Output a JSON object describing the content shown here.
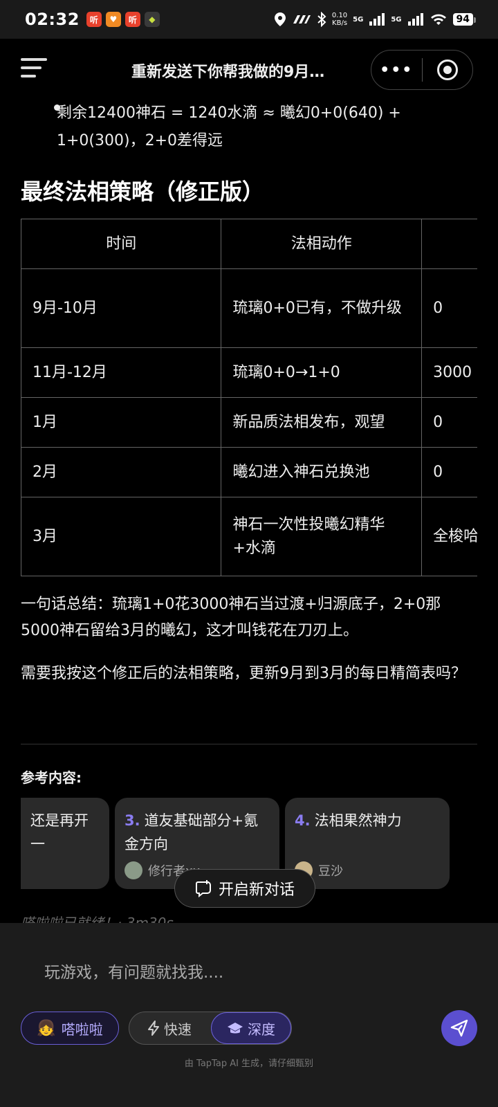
{
  "status_bar": {
    "time": "02:32",
    "apps": [
      {
        "icon": "ting-app-icon",
        "label": "听",
        "color": "#e8412c"
      },
      {
        "icon": "heart-app-icon",
        "label": "♥",
        "color": "#f08a24"
      },
      {
        "icon": "ting-app-icon-2",
        "label": "听",
        "color": "#e8412c"
      },
      {
        "icon": "game-app-icon",
        "label": "◆",
        "color": "#3a3a3a"
      }
    ],
    "network_speed": "0.10",
    "network_unit": "KB/s",
    "signal_1": "5G",
    "signal_2": "5G",
    "battery": "94"
  },
  "header": {
    "title": "重新发送下你帮我做的9月…",
    "more_label": "•••"
  },
  "content": {
    "bullet": "剩余12400神石 = 1240水滴 ≈ 曦幻0+0(640) + 1+0(300)，2+0差得远",
    "section_title": "最终法相策略（修正版）",
    "table": {
      "headers": [
        "时间",
        "法相动作",
        ""
      ],
      "rows": [
        [
          "9月-10月",
          "琉璃0+0已有，不做升级",
          "0"
        ],
        [
          "11月-12月",
          "琉璃0+0→1+0",
          "3000"
        ],
        [
          "1月",
          "新品质法相发布，观望",
          "0"
        ],
        [
          "2月",
          "曦幻进入神石兑换池",
          "0"
        ],
        [
          "3月",
          "神石一次性投曦幻精华+水滴",
          "全梭哈"
        ]
      ]
    },
    "summary": "一句话总结：琉璃1+0花3000神石当过渡+归源底子，2+0那5000神石留给3月的曦幻，这才叫钱花在刀刃上。",
    "question": "需要我按这个修正后的法相策略，更新9月到3月的每日精简表吗？",
    "references_title": "参考内容:",
    "references": [
      {
        "number": "",
        "title": "还是再开一",
        "author": ""
      },
      {
        "number": "3.",
        "title": "道友基础部分+氪金方向",
        "author": "修行者xx"
      },
      {
        "number": "4.",
        "title": "法相果然神力",
        "author": "豆沙"
      }
    ],
    "new_chat_label": "开启新对话",
    "ready_text": "嗒啦啦已就绪！· 3m30s"
  },
  "input": {
    "placeholder": "玩游戏，有问题就找我....",
    "bot_label": "嗒啦啦",
    "fast_label": "快速",
    "deep_label": "深度",
    "footer_note": "由 TapTap AI 生成，请仔细甄别"
  },
  "colors": {
    "accent": "#5b4fd0",
    "background": "#000000",
    "panel": "#1c1c1c"
  }
}
